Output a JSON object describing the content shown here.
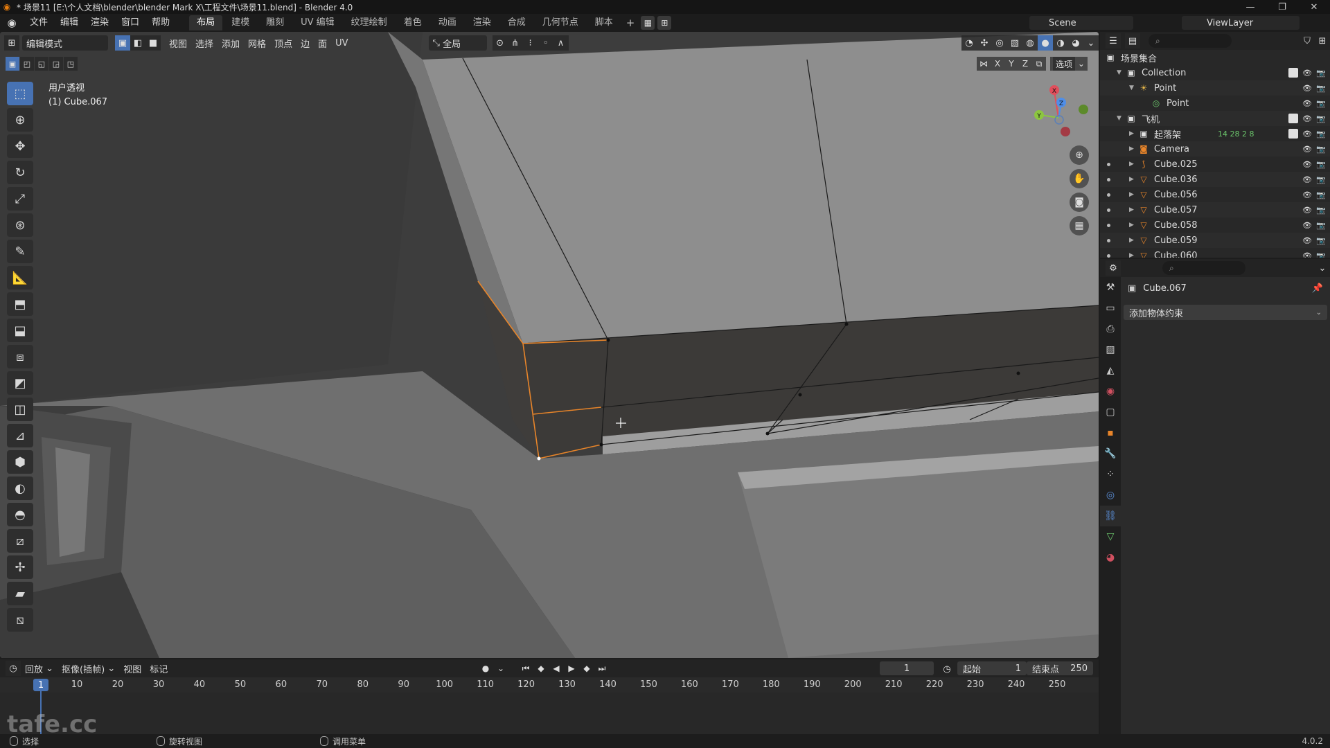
{
  "titlebar": {
    "title": "* 场景11 [E:\\个人文档\\blender\\blender Mark X\\工程文件\\场景11.blend] - Blender 4.0",
    "minimize": "—",
    "maximize": "❐",
    "close": "✕"
  },
  "menubar": {
    "menus": [
      "文件",
      "编辑",
      "渲染",
      "窗口",
      "帮助"
    ],
    "workspaces": [
      "布局",
      "建模",
      "雕刻",
      "UV 编辑",
      "纹理绘制",
      "着色",
      "动画",
      "渲染",
      "合成",
      "几何节点",
      "脚本"
    ],
    "active_workspace": "布局",
    "scene": "Scene",
    "view_layer": "ViewLayer"
  },
  "viewport": {
    "mode": "编辑模式",
    "menus": [
      "视图",
      "选择",
      "添加",
      "网格",
      "顶点",
      "边",
      "面",
      "UV"
    ],
    "transform_orientation": "全局",
    "view_name": "用户透视",
    "object_label": "(1) Cube.067",
    "options_label": "选项",
    "axis_labels": [
      "X",
      "Y",
      "Z"
    ],
    "gizmo": {
      "x": "X",
      "y": "Y",
      "z": "Z"
    }
  },
  "toolbar": {
    "tools": [
      "select-box",
      "cursor",
      "move",
      "rotate",
      "scale",
      "transform",
      "annotate",
      "measure",
      "add-cube",
      "extrude",
      "inset",
      "bevel",
      "loop-cut",
      "knife",
      "poly-build",
      "spin",
      "smooth",
      "edge-slide",
      "shrink-fatten",
      "shear",
      "rip"
    ]
  },
  "timeline": {
    "menus": [
      "回放",
      "抠像(插帧)",
      "视图",
      "标记"
    ],
    "current_frame": "1",
    "start_label": "起始",
    "start": "1",
    "end_label": "结束点",
    "end": "250",
    "ruler": [
      "10",
      "20",
      "30",
      "40",
      "50",
      "60",
      "70",
      "80",
      "90",
      "100",
      "110",
      "120",
      "130",
      "140",
      "150",
      "160",
      "170",
      "180",
      "190",
      "200",
      "210",
      "220",
      "230",
      "240",
      "250"
    ],
    "ruler_current": "1"
  },
  "statusbar": {
    "items": [
      "选择",
      "旋转视图",
      "调用菜单"
    ],
    "version": "4.0.2"
  },
  "watermark": "tafe.cc",
  "outliner": {
    "root": "场景集合",
    "rows": [
      {
        "name": "Collection",
        "indent": 1,
        "arrow": "▼",
        "icon": "collection-icon",
        "checkbox": true
      },
      {
        "name": "Point",
        "indent": 2,
        "arrow": "▼",
        "icon": "light-icon",
        "checkbox": false
      },
      {
        "name": "Point",
        "indent": 3,
        "arrow": "",
        "icon": "light-data-icon",
        "checkbox": false
      },
      {
        "name": "飞机",
        "indent": 1,
        "arrow": "▼",
        "icon": "collection-icon",
        "checkbox": true
      },
      {
        "name": "起落架",
        "indent": 2,
        "arrow": "▶",
        "icon": "collection-icon",
        "checkbox": true,
        "extra": "14  28  2  8"
      },
      {
        "name": "Camera",
        "indent": 2,
        "arrow": "▶",
        "icon": "camera-icon",
        "checkbox": false
      },
      {
        "name": "Cube.025",
        "indent": 2,
        "arrow": "▶",
        "icon": "curve-icon",
        "checkbox": false
      },
      {
        "name": "Cube.036",
        "indent": 2,
        "arrow": "▶",
        "icon": "mesh-icon",
        "checkbox": false
      },
      {
        "name": "Cube.056",
        "indent": 2,
        "arrow": "▶",
        "icon": "mesh-icon",
        "checkbox": false
      },
      {
        "name": "Cube.057",
        "indent": 2,
        "arrow": "▶",
        "icon": "mesh-icon",
        "checkbox": false
      },
      {
        "name": "Cube.058",
        "indent": 2,
        "arrow": "▶",
        "icon": "mesh-icon",
        "checkbox": false
      },
      {
        "name": "Cube.059",
        "indent": 2,
        "arrow": "▶",
        "icon": "mesh-icon",
        "checkbox": false
      },
      {
        "name": "Cube.060",
        "indent": 2,
        "arrow": "▶",
        "icon": "mesh-icon",
        "checkbox": false
      }
    ]
  },
  "properties": {
    "object_name": "Cube.067",
    "add_constraint": "添加物体约束"
  },
  "colors": {
    "accent": "#4772b3",
    "viewport_bg": "#3d3d3d",
    "selected_edge": "#e8852a",
    "mesh_icon": "#e8852a",
    "data_icon": "#6bc46b"
  }
}
